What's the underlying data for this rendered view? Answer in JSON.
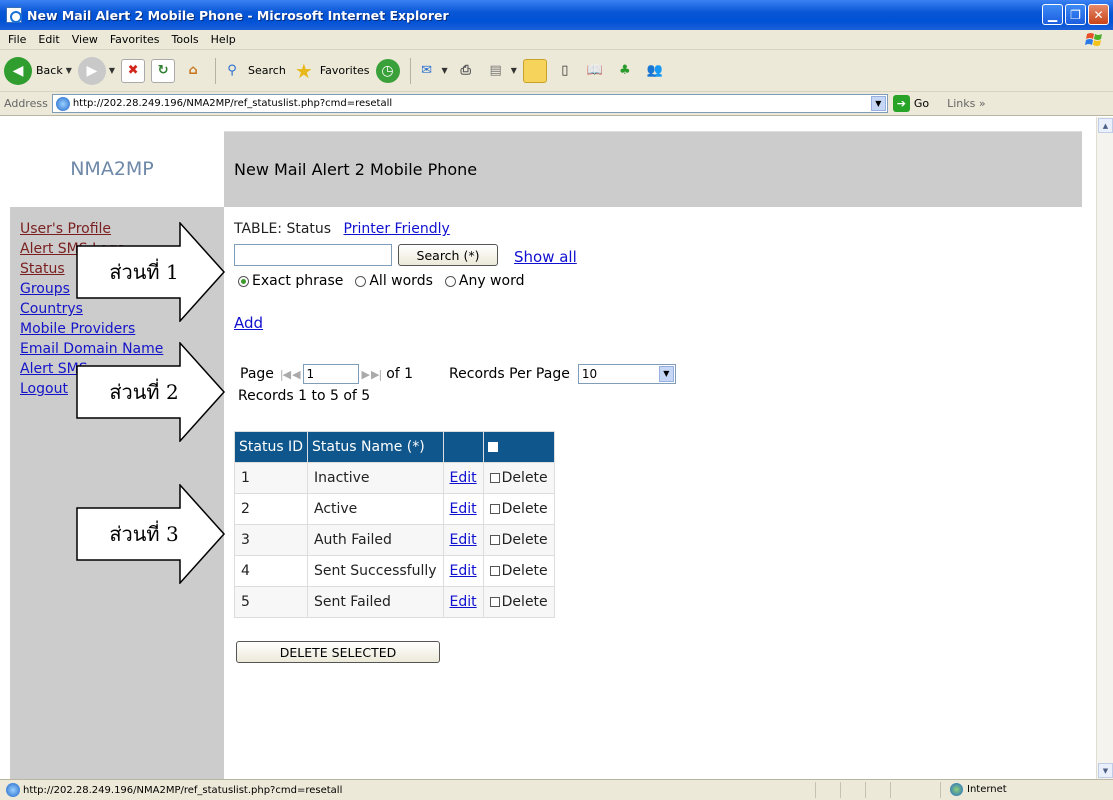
{
  "window": {
    "title": "New Mail Alert 2 Mobile Phone - Microsoft Internet Explorer",
    "controls": [
      "minimize",
      "restore",
      "close"
    ]
  },
  "menubar": {
    "items": [
      "File",
      "Edit",
      "View",
      "Favorites",
      "Tools",
      "Help"
    ]
  },
  "toolbar": {
    "back_label": "Back",
    "search_label": "Search",
    "favorites_label": "Favorites"
  },
  "address": {
    "label": "Address",
    "url": "http://202.28.249.196/NMA2MP/ref_statuslist.php?cmd=resetall",
    "go_label": "Go",
    "links_label": "Links"
  },
  "page": {
    "brand": "NMA2MP",
    "header_title": "New Mail Alert 2 Mobile Phone",
    "sidebar": {
      "items": [
        {
          "label": "User's Profile"
        },
        {
          "label": "Alert SMS Logs"
        },
        {
          "label": "Status"
        },
        {
          "label": "Groups"
        },
        {
          "label": "Countrys"
        },
        {
          "label": "Mobile Providers"
        },
        {
          "label": "Email Domain Name"
        },
        {
          "label": "Alert SMS"
        },
        {
          "label": "Logout"
        }
      ]
    },
    "table_label": "TABLE: Status",
    "printer_friendly": "Printer Friendly",
    "search": {
      "value": "",
      "button": "Search (*)",
      "show_all": "Show all",
      "options": [
        "Exact phrase",
        "All words",
        "Any word"
      ],
      "selected": "Exact phrase"
    },
    "add_label": "Add",
    "pager": {
      "page_label": "Page",
      "page_value": "1",
      "of_label": "of 1",
      "rpp_label": "Records Per Page",
      "rpp_value": "10",
      "records_text": "Records 1 to 5 of 5"
    },
    "grid": {
      "headers": [
        "Status ID",
        "Status Name (*)",
        "",
        ""
      ],
      "rows": [
        {
          "id": "1",
          "name": "Inactive",
          "edit": "Edit",
          "delete": "Delete"
        },
        {
          "id": "2",
          "name": "Active",
          "edit": "Edit",
          "delete": "Delete"
        },
        {
          "id": "3",
          "name": "Auth Failed",
          "edit": "Edit",
          "delete": "Delete"
        },
        {
          "id": "4",
          "name": "Sent Successfully",
          "edit": "Edit",
          "delete": "Delete"
        },
        {
          "id": "5",
          "name": "Sent Failed",
          "edit": "Edit",
          "delete": "Delete"
        }
      ]
    },
    "delete_selected": "DELETE SELECTED"
  },
  "annotations": [
    {
      "label": "ส่วนที่ 1"
    },
    {
      "label": "ส่วนที่ 2"
    },
    {
      "label": "ส่วนที่ 3"
    }
  ],
  "statusbar": {
    "text": "http://202.28.249.196/NMA2MP/ref_statuslist.php?cmd=resetall",
    "zone": "Internet"
  },
  "colors": {
    "titlebar": "#0a57d6",
    "grid_header": "#0f568c",
    "sidebar_bg": "#cccccc",
    "link": "#1010d0"
  }
}
